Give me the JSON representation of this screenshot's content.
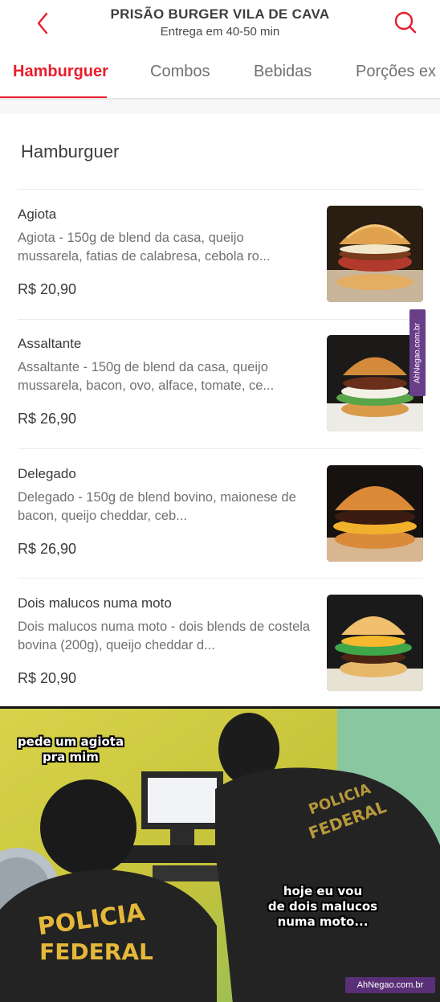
{
  "header": {
    "store_name": "PRISÃO BURGER VILA DE CAVA",
    "delivery_time": "Entrega em 40-50 min"
  },
  "tabs": [
    {
      "label": "Hamburguer",
      "active": true
    },
    {
      "label": "Combos",
      "active": false
    },
    {
      "label": "Bebidas",
      "active": false
    },
    {
      "label": "Porções ex",
      "active": false
    }
  ],
  "section": {
    "title": "Hamburguer",
    "items": [
      {
        "name": "Agiota",
        "description": "Agiota - 150g de blend da casa, queijo mussarela, fatias de calabresa, cebola ro...",
        "price": "R$ 20,90"
      },
      {
        "name": "Assaltante",
        "description": "Assaltante - 150g de blend da casa, queijo mussarela, bacon, ovo, alface, tomate, ce...",
        "price": "R$ 26,90"
      },
      {
        "name": "Delegado",
        "description": "Delegado - 150g de blend  bovino, maionese de bacon, queijo cheddar, ceb...",
        "price": "R$ 26,90"
      },
      {
        "name": "Dois malucos numa moto",
        "description": "Dois malucos numa moto - dois blends de costela bovina (200g), queijo cheddar d...",
        "price": "R$ 20,90"
      }
    ]
  },
  "watermark": "AhNegao.com.br",
  "meme": {
    "caption_left": "pede um agiota\npra mim",
    "caption_right": "hoje eu vou\nde dois malucos\nnuma moto...",
    "vest_text_1": "POLICIA",
    "vest_text_2": "FEDERAL",
    "vest_text_3": "POLICIA",
    "vest_text_4": "FEDERAL",
    "watermark": "AhNegao.com.br"
  },
  "colors": {
    "accent": "#ea1d2c",
    "text": "#3e3e3e",
    "muted": "#717171",
    "watermark": "#5b2f77"
  },
  "icons": {
    "back": "chevron-left-icon",
    "search": "search-icon"
  }
}
